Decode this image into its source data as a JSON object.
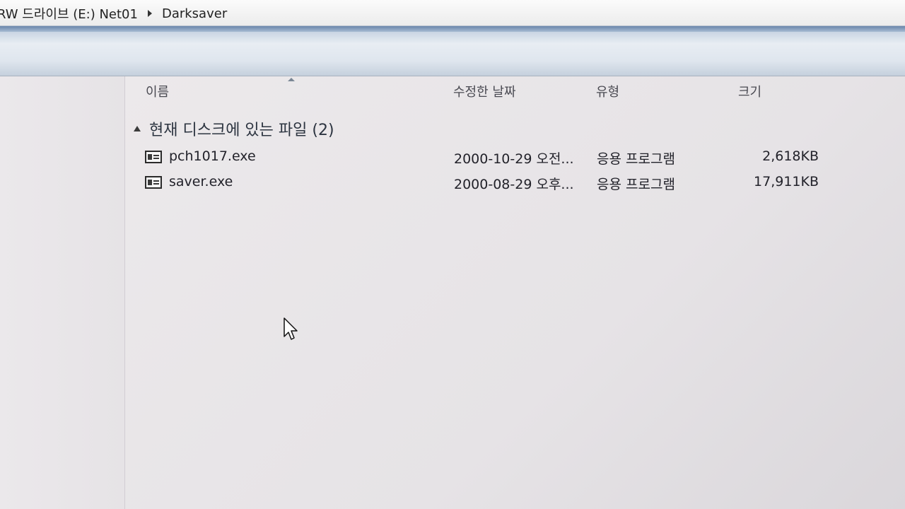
{
  "address_bar": {
    "crumbs": [
      "RW 드라이브 (E:) Net01",
      "Darksaver"
    ]
  },
  "columns": {
    "name": "이름",
    "date_modified": "수정한 날짜",
    "type": "유형",
    "size": "크기"
  },
  "group": {
    "label": "현재 디스크에 있는 파일 (2)"
  },
  "files": [
    {
      "name": "pch1017.exe",
      "date": "2000-10-29 오전...",
      "type": "응용 프로그램",
      "size": "2,618KB"
    },
    {
      "name": "saver.exe",
      "date": "2000-08-29 오후...",
      "type": "응용 프로그램",
      "size": "17,911KB"
    }
  ]
}
